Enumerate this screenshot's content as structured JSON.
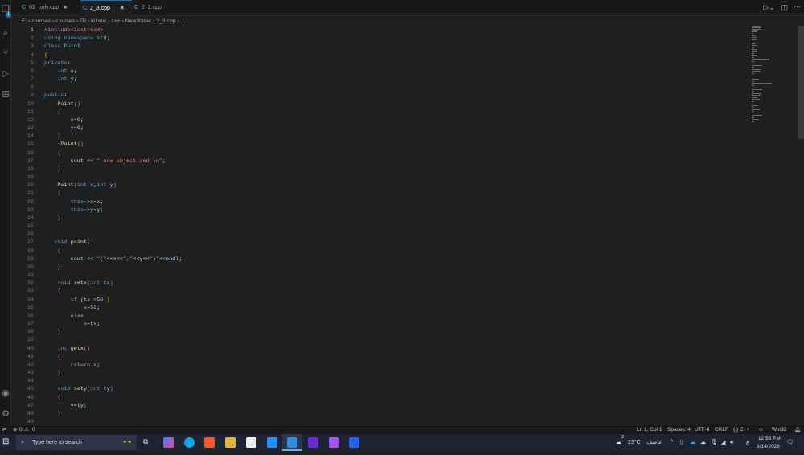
{
  "tabs": [
    {
      "label": "03_poly.cpp",
      "indicator": "●"
    },
    {
      "label": "2_3.cpp",
      "indicator": "✕"
    },
    {
      "label": "2_2.cpp",
      "indicator": ""
    }
  ],
  "breadcrumb": "E: › courses › courses › ITI › iti laps › c++ › New folder › 2_3.cpp › ...",
  "explorer_badge": "1",
  "code": [
    [
      [
        "inc",
        "#include"
      ],
      [
        "str",
        "<iostream>"
      ]
    ],
    [
      [
        "kw",
        "using"
      ],
      [
        "p",
        " "
      ],
      [
        "kw",
        "namespace"
      ],
      [
        "cls",
        " std"
      ],
      [
        "p",
        ";"
      ]
    ],
    [
      [
        "kw",
        "class"
      ],
      [
        "p",
        " "
      ],
      [
        "cls",
        "Point"
      ]
    ],
    [
      [
        "b1",
        "{"
      ]
    ],
    [
      [
        "kw",
        "private"
      ],
      [
        "p",
        ":"
      ]
    ],
    [
      [
        "p",
        "    "
      ],
      [
        "kw",
        "int"
      ],
      [
        "var",
        " x"
      ],
      [
        "p",
        ";"
      ]
    ],
    [
      [
        "p",
        "    "
      ],
      [
        "kw",
        "int"
      ],
      [
        "var",
        " y"
      ],
      [
        "p",
        ";"
      ]
    ],
    [],
    [
      [
        "kw",
        "public"
      ],
      [
        "p",
        ":"
      ]
    ],
    [
      [
        "p",
        "    "
      ],
      [
        "fn",
        "Point"
      ],
      [
        "b2",
        "()"
      ]
    ],
    [
      [
        "p",
        "    "
      ],
      [
        "b2",
        "{"
      ]
    ],
    [
      [
        "p",
        "        "
      ],
      [
        "var",
        "x"
      ],
      [
        "p",
        "=0;"
      ]
    ],
    [
      [
        "p",
        "        "
      ],
      [
        "var",
        "y"
      ],
      [
        "p",
        "=0;"
      ]
    ],
    [
      [
        "p",
        "    "
      ],
      [
        "b2",
        "}"
      ]
    ],
    [
      [
        "p",
        "    ~"
      ],
      [
        "fn",
        "Point"
      ],
      [
        "b2",
        "()"
      ]
    ],
    [
      [
        "p",
        "    "
      ],
      [
        "b2",
        "{"
      ]
    ],
    [
      [
        "p",
        "        "
      ],
      [
        "var",
        "cout"
      ],
      [
        "p",
        " << "
      ],
      [
        "str",
        "\" now object ded \\n\""
      ],
      [
        "p",
        ";"
      ]
    ],
    [
      [
        "p",
        "    "
      ],
      [
        "b2",
        "}"
      ]
    ],
    [],
    [
      [
        "p",
        "    "
      ],
      [
        "fn",
        "Point"
      ],
      [
        "b2",
        "("
      ],
      [
        "kw",
        "int"
      ],
      [
        "var",
        " x"
      ],
      [
        "p",
        ","
      ],
      [
        "kw",
        "int"
      ],
      [
        "var",
        " y"
      ],
      [
        "b2",
        ")"
      ]
    ],
    [
      [
        "p",
        "    "
      ],
      [
        "b2",
        "{"
      ]
    ],
    [
      [
        "p",
        "        "
      ],
      [
        "kw",
        "this"
      ],
      [
        "p",
        "->"
      ],
      [
        "var",
        "x"
      ],
      [
        "p",
        "="
      ],
      [
        "var",
        "x"
      ],
      [
        "p",
        ";"
      ]
    ],
    [
      [
        "p",
        "        "
      ],
      [
        "kw",
        "this"
      ],
      [
        "p",
        "->"
      ],
      [
        "var",
        "y"
      ],
      [
        "p",
        "="
      ],
      [
        "var",
        "y"
      ],
      [
        "p",
        ";"
      ]
    ],
    [
      [
        "p",
        "    "
      ],
      [
        "b2",
        "}"
      ]
    ],
    [],
    [],
    [
      [
        "p",
        "   "
      ],
      [
        "kw",
        "void"
      ],
      [
        "p",
        " "
      ],
      [
        "fn",
        "print"
      ],
      [
        "b2",
        "()"
      ]
    ],
    [
      [
        "p",
        "    "
      ],
      [
        "b2",
        "{"
      ]
    ],
    [
      [
        "p",
        "        "
      ],
      [
        "var",
        "cout"
      ],
      [
        "p",
        " << "
      ],
      [
        "str",
        "\"(\""
      ],
      [
        "p",
        "<<"
      ],
      [
        "var",
        "x"
      ],
      [
        "p",
        "<<"
      ],
      [
        "str",
        "\",\""
      ],
      [
        "p",
        "<<"
      ],
      [
        "var",
        "y"
      ],
      [
        "p",
        "<<"
      ],
      [
        "str",
        "\")\""
      ],
      [
        "p",
        "<<"
      ],
      [
        "var",
        "endl"
      ],
      [
        "p",
        ";"
      ]
    ],
    [
      [
        "p",
        "    "
      ],
      [
        "b2",
        "}"
      ]
    ],
    [],
    [
      [
        "p",
        "    "
      ],
      [
        "kw",
        "void"
      ],
      [
        "p",
        " "
      ],
      [
        "fn",
        "setx"
      ],
      [
        "b2",
        "("
      ],
      [
        "kw",
        "int"
      ],
      [
        "var",
        " tx"
      ],
      [
        "b2",
        ")"
      ]
    ],
    [
      [
        "p",
        "    "
      ],
      [
        "b2",
        "{"
      ]
    ],
    [
      [
        "p",
        "        "
      ],
      [
        "inc",
        "if"
      ],
      [
        "p",
        " "
      ],
      [
        "b1",
        "("
      ],
      [
        "var",
        "tx"
      ],
      [
        "p",
        " >50 "
      ],
      [
        "b1",
        ")"
      ]
    ],
    [
      [
        "p",
        "            "
      ],
      [
        "var",
        "x"
      ],
      [
        "p",
        "=50;"
      ]
    ],
    [
      [
        "p",
        "        "
      ],
      [
        "inc",
        "else"
      ]
    ],
    [
      [
        "p",
        "            "
      ],
      [
        "var",
        "x"
      ],
      [
        "p",
        "="
      ],
      [
        "var",
        "tx"
      ],
      [
        "p",
        ";"
      ]
    ],
    [
      [
        "p",
        "    "
      ],
      [
        "b2",
        "}"
      ]
    ],
    [],
    [
      [
        "p",
        "    "
      ],
      [
        "kw",
        "int"
      ],
      [
        "p",
        " "
      ],
      [
        "fn",
        "getx"
      ],
      [
        "b2",
        "()"
      ]
    ],
    [
      [
        "p",
        "    "
      ],
      [
        "b2",
        "{"
      ]
    ],
    [
      [
        "p",
        "        "
      ],
      [
        "inc",
        "return"
      ],
      [
        "var",
        " x"
      ],
      [
        "p",
        ";"
      ]
    ],
    [
      [
        "p",
        "    "
      ],
      [
        "b2",
        "}"
      ]
    ],
    [],
    [
      [
        "p",
        "    "
      ],
      [
        "kw",
        "void"
      ],
      [
        "p",
        " "
      ],
      [
        "fn",
        "sety"
      ],
      [
        "b2",
        "("
      ],
      [
        "kw",
        "int"
      ],
      [
        "var",
        " ty"
      ],
      [
        "b2",
        ")"
      ]
    ],
    [
      [
        "p",
        "    "
      ],
      [
        "b2",
        "{"
      ]
    ],
    [
      [
        "p",
        "        "
      ],
      [
        "var",
        "y"
      ],
      [
        "p",
        "="
      ],
      [
        "var",
        "ty"
      ],
      [
        "p",
        ";"
      ]
    ],
    [
      [
        "p",
        "    "
      ],
      [
        "b2",
        "}"
      ]
    ],
    []
  ],
  "status": {
    "errors": "0",
    "warnings": "0",
    "position": "Ln 1, Col 1",
    "spaces": "Spaces: 4",
    "encoding": "UTF-8",
    "eol": "CRLF",
    "language": "{ } C++",
    "platform": "Win32"
  },
  "taskbar": {
    "search_placeholder": "Type here to search",
    "temperature": "23°C",
    "weather": "عاصف",
    "lang": "ع",
    "time": "12:58 PM",
    "date": "3/14/2026",
    "weather_badge": "2"
  }
}
